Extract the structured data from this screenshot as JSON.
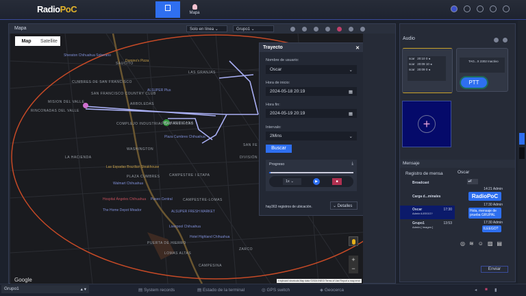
{
  "header": {
    "logo": "RadioPoC",
    "tabs": [
      {
        "label": "",
        "active": true
      },
      {
        "label": "Mapa",
        "active": false
      }
    ]
  },
  "map_panel": {
    "title": "Mapa",
    "filter": "Solo en línea",
    "group": "Grupo1",
    "toggle": [
      "Map",
      "Satellite"
    ],
    "labels": [
      "SAUCITO",
      "LAS GRANJAS",
      "PANAMERICANA",
      "CUMBRES DE SAN FRANCISCO",
      "SAN FRANCISCO COUNTRY CLUB",
      "MISION DEL VALLE",
      "RINCONADAS DEL VALLE",
      "COMPLEJO INDUSTRIAL LAS AMERICAS",
      "WASHINGTON",
      "LA HACIENDA",
      "PLAZA CUMBRES",
      "CAMPESTRE I ETAPA",
      "CAMPESTRE-LOMAS",
      "PUERTA DE HIERRO",
      "LOMAS ALTAS",
      "CAMPESINA",
      "ZARCO",
      "ARBOLEDAS",
      "SAN FE I ETA",
      "DIVISIÓN DEL NORTE"
    ],
    "pois": [
      "Sheraton Chihuahua Soberano",
      "Domino's Pizza",
      "ALSUPER Plus",
      "Plaza Cumbres Chihuahua",
      "Las Espadas Brazilian Steakhouse",
      "Walmart Chihuahua",
      "Hospital Ángeles Chihuahua",
      "Paseo Central",
      "The Home Depot Mirador",
      "ALSUPER FRESH MARKET",
      "Liverpool Chihuahua",
      "Hotel Highland Chihuahua"
    ],
    "google": "Google",
    "attribution": "Keyboard shortcuts  Map data ©2024 INEGI  Terms of Use  Report a map error"
  },
  "trayecto": {
    "title": "Trayecto",
    "user_label": "Nombre de usuario:",
    "user": "Oscar",
    "start_label": "Hora de inicio:",
    "start": "2024-05-18 20:19",
    "end_label": "Hora fin:",
    "end": "2024-05-19 20:19",
    "interval_label": "Intervalo:",
    "interval": "2Mins",
    "search": "Buscar",
    "progress_label": "Progreso",
    "progress": 0.02,
    "speed": "1x",
    "records": "hay363 registros de ubicación.",
    "details": "Detalles"
  },
  "audio": {
    "title": "Audio",
    "rows": [
      [
        "scar",
        "20:10",
        "0"
      ],
      [
        "scar",
        "20:09",
        "10"
      ],
      [
        "scar",
        "20:09",
        "0"
      ]
    ],
    "channel": "TAG...X 2302  Inactivo",
    "ptt": "PTT"
  },
  "mensaje": {
    "title": "Mensaje",
    "list_title": "Registro de mensa",
    "chat_title": "Oscar",
    "conversations": [
      {
        "name": "Broadcast",
        "sub": "",
        "time": ""
      },
      {
        "name": "Carga d...minales",
        "sub": "",
        "time": ""
      },
      {
        "name": "Oscar",
        "sub": "Admin:ILEEGO?",
        "time": "17:30",
        "active": true
      },
      {
        "name": "Grupo1",
        "sub": "Admin:[ Imagen ]",
        "time": "13:53"
      }
    ],
    "messages": [
      {
        "meta": "14:21 Admin",
        "text": "RadioPoC"
      },
      {
        "meta": "17:30 Admin",
        "text": "Hola, mensaje de prueba GRUPAL"
      },
      {
        "meta": "17:30 Admin",
        "text": "ILEEGO?"
      }
    ],
    "voice": "4'",
    "send": "Enviar"
  },
  "bottom": {
    "group": "Grupo1",
    "items": [
      "System records",
      "Estado de la terminal",
      "GPS switch",
      "Geocerca"
    ]
  }
}
